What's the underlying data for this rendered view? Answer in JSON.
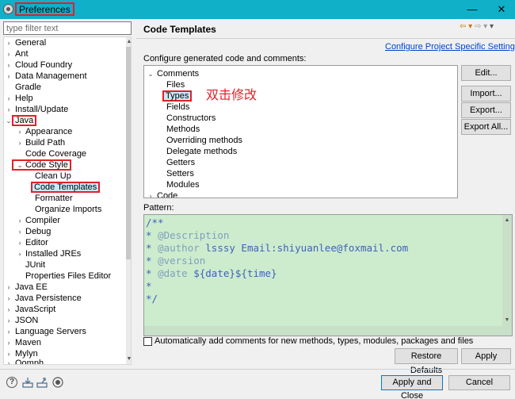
{
  "window": {
    "title": "Preferences",
    "min_glyph": "—",
    "max_glyph": "☐",
    "close_glyph": "✕"
  },
  "filter": {
    "placeholder": "type filter text"
  },
  "tree": {
    "items": [
      {
        "label": "General"
      },
      {
        "label": "Ant"
      },
      {
        "label": "Cloud Foundry"
      },
      {
        "label": "Data Management"
      },
      {
        "label": "Gradle"
      },
      {
        "label": "Help"
      },
      {
        "label": "Install/Update"
      },
      {
        "label": "Java"
      },
      {
        "label": "Appearance"
      },
      {
        "label": "Build Path"
      },
      {
        "label": "Code Coverage"
      },
      {
        "label": "Code Style"
      },
      {
        "label": "Clean Up"
      },
      {
        "label": "Code Templates"
      },
      {
        "label": "Formatter"
      },
      {
        "label": "Organize Imports"
      },
      {
        "label": "Compiler"
      },
      {
        "label": "Debug"
      },
      {
        "label": "Editor"
      },
      {
        "label": "Installed JREs"
      },
      {
        "label": "JUnit"
      },
      {
        "label": "Properties Files Editor"
      },
      {
        "label": "Java EE"
      },
      {
        "label": "Java Persistence"
      },
      {
        "label": "JavaScript"
      },
      {
        "label": "JSON"
      },
      {
        "label": "Language Servers"
      },
      {
        "label": "Maven"
      },
      {
        "label": "Mylyn"
      },
      {
        "label": "Oomph"
      }
    ]
  },
  "page": {
    "title": "Code Templates",
    "configure_link": "Configure Project Specific Settings...",
    "description": "Configure generated code and comments:",
    "annotation": "双击修改",
    "templates": [
      {
        "label": "Comments"
      },
      {
        "label": "Files"
      },
      {
        "label": "Types"
      },
      {
        "label": "Fields"
      },
      {
        "label": "Constructors"
      },
      {
        "label": "Methods"
      },
      {
        "label": "Overriding methods"
      },
      {
        "label": "Delegate methods"
      },
      {
        "label": "Getters"
      },
      {
        "label": "Setters"
      },
      {
        "label": "Modules"
      },
      {
        "label": "Code"
      }
    ],
    "buttons": {
      "edit": "Edit...",
      "import": "Import...",
      "export": "Export...",
      "export_all": "Export All..."
    },
    "pattern_label": "Pattern:",
    "pattern": {
      "l1": "/**",
      "l2_star": "* ",
      "l2_tag": "@Description",
      "l3_star": "* ",
      "l3_tag": "@author",
      "l3_text": " lsssy Email:shiyuanlee@foxmail.com",
      "l4_star": "* ",
      "l4_tag": "@version",
      "l5_star": "* ",
      "l5_tag": "@date",
      "l5_text": " ${date}${time}",
      "l6": "*",
      "l7": "*/"
    },
    "auto_comments_label": "Automatically add comments for new methods, types, modules, packages and files",
    "restore_defaults": "Restore Defaults",
    "apply": "Apply"
  },
  "footer": {
    "apply_close": "Apply and Close",
    "cancel": "Cancel",
    "help_glyph": "?"
  },
  "colors": {
    "titlebar": "#0fb0c8",
    "highlight_box": "#e0202a",
    "pattern_bg": "#cdeccd",
    "link": "#0044cc"
  }
}
